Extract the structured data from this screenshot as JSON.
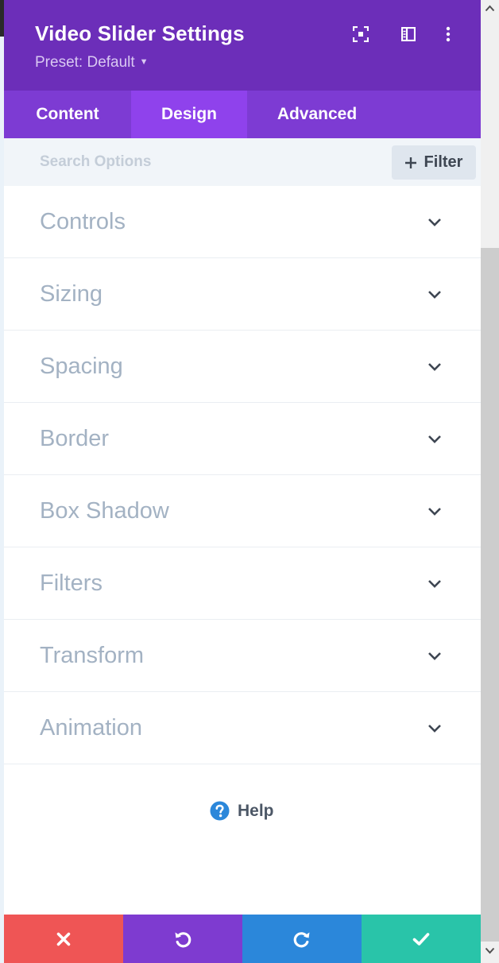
{
  "header": {
    "title": "Video Slider Settings",
    "preset_label": "Preset: Default",
    "icons": [
      "expand-icon",
      "sidebar-toggle-icon",
      "more-menu-icon"
    ],
    "background": "#6c2eb9"
  },
  "tabs": [
    {
      "label": "Content",
      "active": false
    },
    {
      "label": "Design",
      "active": true
    },
    {
      "label": "Advanced",
      "active": false
    }
  ],
  "search": {
    "placeholder": "Search Options",
    "value": "",
    "filter_label": "Filter"
  },
  "groups": [
    {
      "label": "Controls"
    },
    {
      "label": "Sizing"
    },
    {
      "label": "Spacing"
    },
    {
      "label": "Border"
    },
    {
      "label": "Box Shadow"
    },
    {
      "label": "Filters"
    },
    {
      "label": "Transform"
    },
    {
      "label": "Animation"
    }
  ],
  "help": {
    "label": "Help"
  },
  "footer": {
    "buttons": [
      {
        "icon": "close-icon",
        "color": "#ef5555"
      },
      {
        "icon": "undo-icon",
        "color": "#7e3bd0"
      },
      {
        "icon": "redo-icon",
        "color": "#2b87da"
      },
      {
        "icon": "check-icon",
        "color": "#29c4a9"
      }
    ]
  }
}
